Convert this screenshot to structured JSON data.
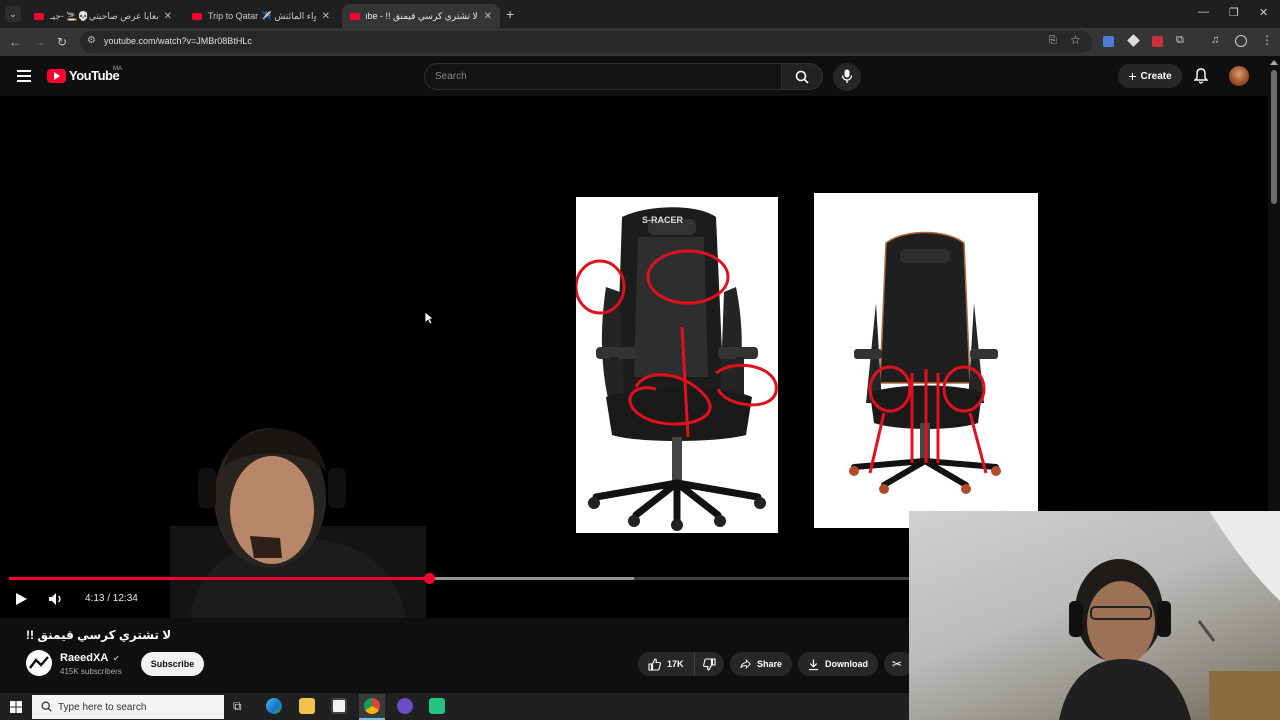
{
  "browser": {
    "tabs": [
      {
        "label": "دوزو معايا عرص صاحبتي💀🚬 -جيـ"
      },
      {
        "label": "Trip to Qatar ✈️ في أجواء المائتش"
      },
      {
        "label": "لا تشتري كرسي قيمنق !! - YouTube"
      }
    ],
    "new_tab_glyph": "+",
    "url": "youtube.com/watch?v=JMBr08BtHLc"
  },
  "youtube": {
    "logo_text": "YouTube",
    "region_code": "MA",
    "search_placeholder": "Search",
    "create_label": "Create"
  },
  "video": {
    "timecode": "4:13 / 12:34",
    "progress_fraction": 0.336,
    "buffered_fraction": 0.5,
    "image_brand_text": "S-RACER",
    "title": "لا تشتري كرسي قيمنق !!",
    "channel_name": "RaeedXA",
    "subscribers": "415K subscribers",
    "subscribe_label": "Subscribe",
    "like_count": "17K",
    "share_label": "Share",
    "download_label": "Download"
  },
  "taskbar": {
    "search_placeholder": "Type here to search"
  },
  "colors": {
    "accent": "#ff0033",
    "background": "#0f0f0f",
    "annotation": "#e0101e"
  }
}
